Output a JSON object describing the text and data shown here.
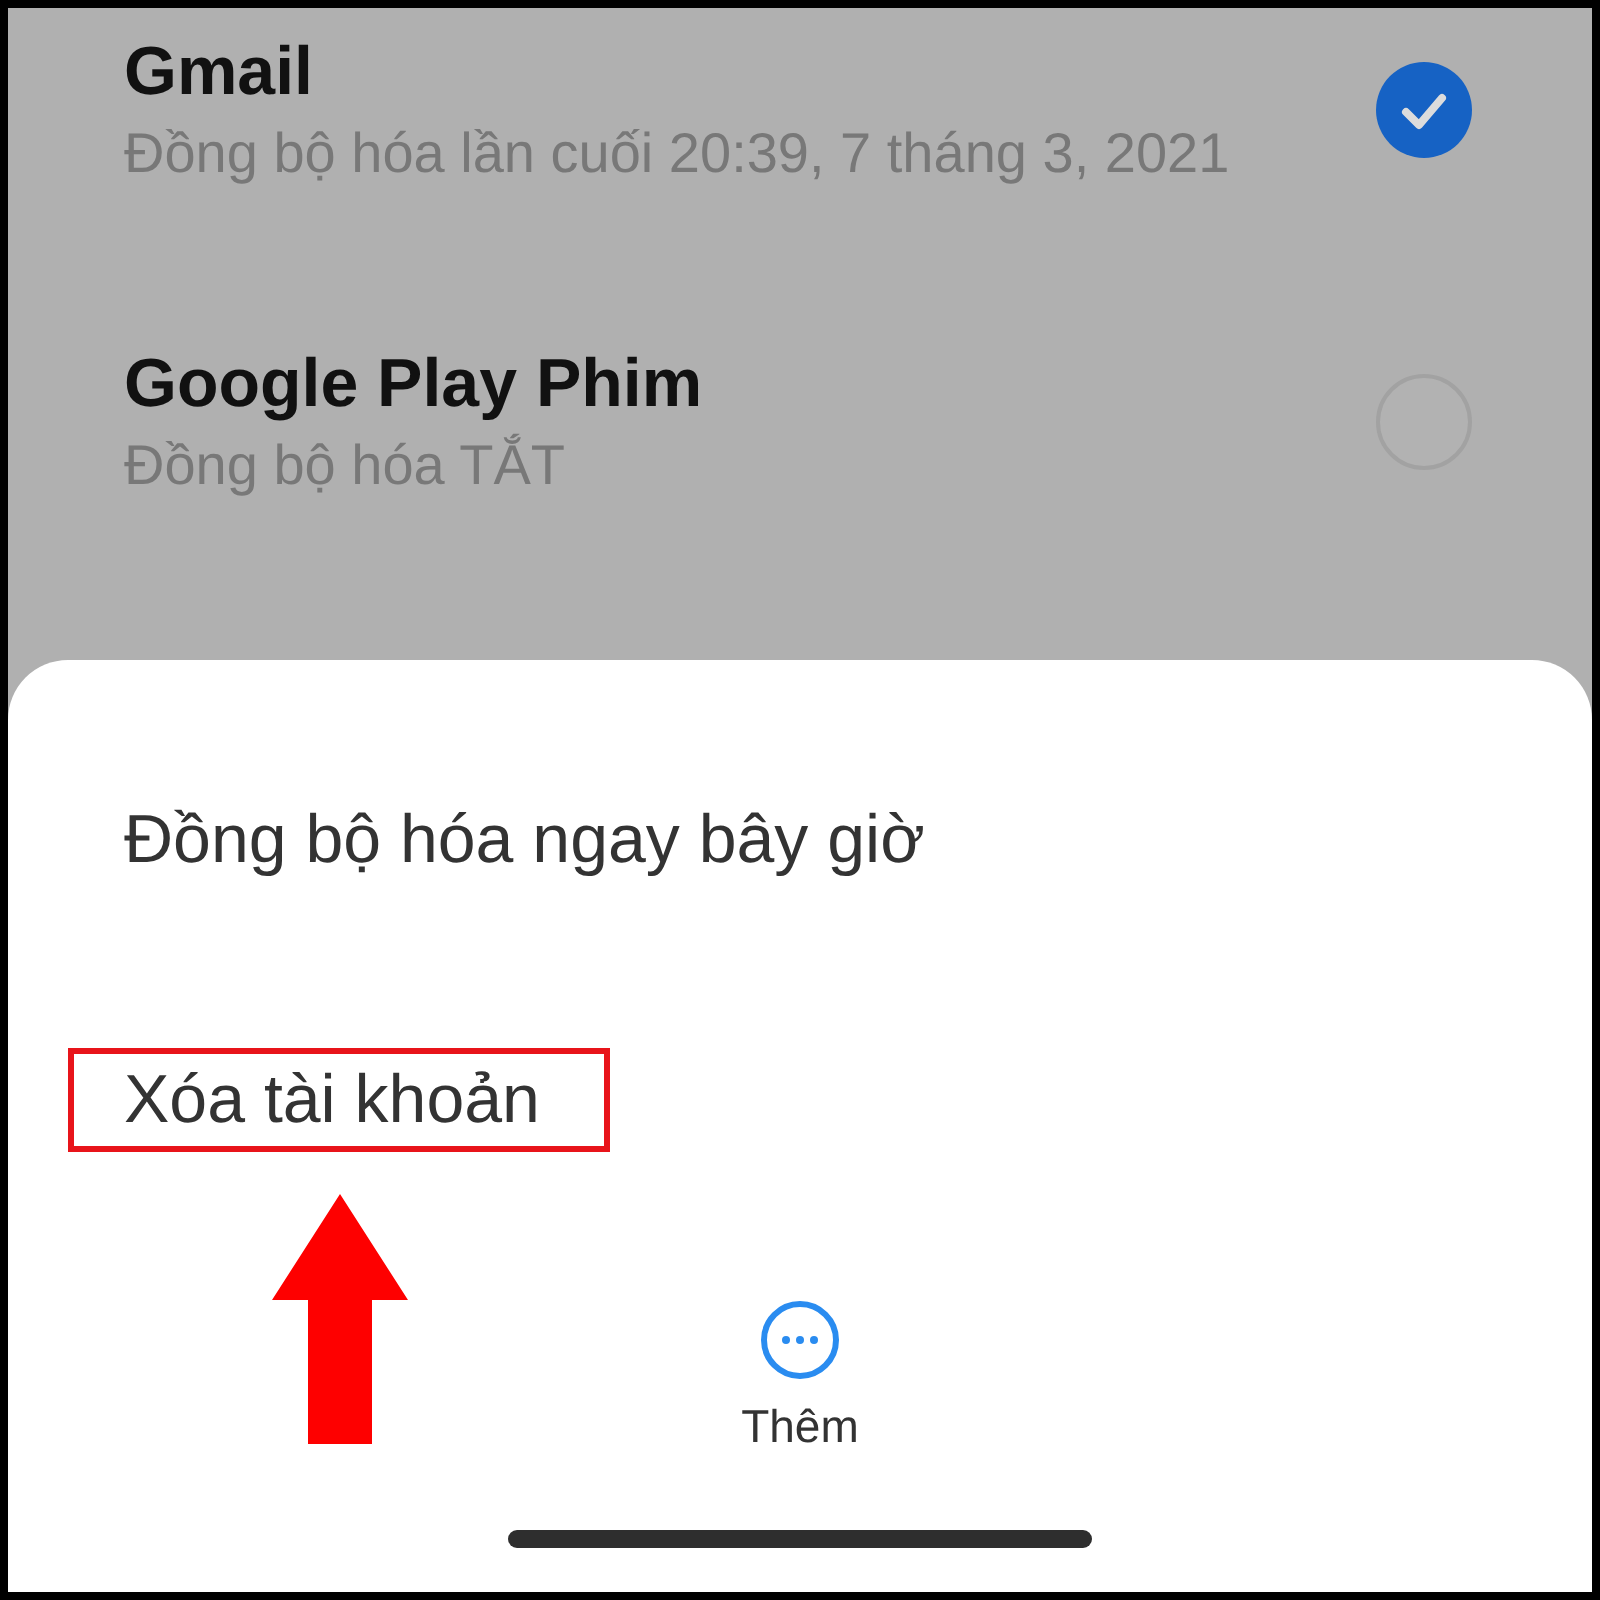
{
  "accounts": [
    {
      "title": "Gmail",
      "subtitle": "Đồng bộ hóa lần cuối 20:39, 7 tháng 3, 2021",
      "checked": true
    },
    {
      "title": "Google Play Phim",
      "subtitle": "Đồng bộ hóa TẮT",
      "checked": false
    }
  ],
  "sheet": {
    "actions": [
      {
        "label": "Đồng bộ hóa ngay bây giờ",
        "highlighted": false
      },
      {
        "label": "Xóa tài khoản",
        "highlighted": true
      }
    ],
    "more_button": {
      "label": "Thêm"
    }
  }
}
